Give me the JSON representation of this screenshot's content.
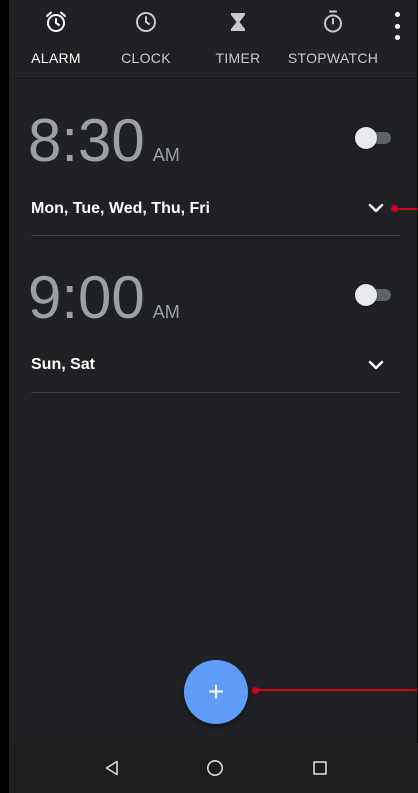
{
  "tabs": [
    {
      "label": "ALARM",
      "icon": "alarm-icon",
      "active": true
    },
    {
      "label": "CLOCK",
      "icon": "clock-icon",
      "active": false
    },
    {
      "label": "TIMER",
      "icon": "hourglass-icon",
      "active": false
    },
    {
      "label": "STOPWATCH",
      "icon": "stopwatch-icon",
      "active": false
    }
  ],
  "overflow_menu": {
    "icon": "more-vert-icon"
  },
  "alarms": [
    {
      "time": "8:30",
      "ampm": "AM",
      "days": "Mon, Tue, Wed, Thu, Fri",
      "enabled": false
    },
    {
      "time": "9:00",
      "ampm": "AM",
      "days": "Sun, Sat",
      "enabled": false
    }
  ],
  "fab": {
    "label": "+",
    "icon": "add-icon"
  },
  "nav": {
    "back": "back-icon",
    "home": "home-icon",
    "recents": "recents-icon"
  },
  "colors": {
    "background": "#202124",
    "time_text": "#9aa0a6",
    "fab": "#5f9cf8",
    "annotation": "#d0021b"
  }
}
